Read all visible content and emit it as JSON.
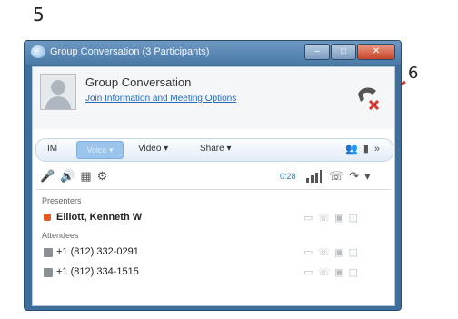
{
  "annotations": {
    "step_left": "5",
    "step_right": "6"
  },
  "window": {
    "title": "Group Conversation (3 Participants)"
  },
  "header": {
    "conversation_title": "Group Conversation",
    "join_link": "Join Information and Meeting Options"
  },
  "modebar": {
    "im_label": "IM",
    "voice_label": "Voice ▾",
    "video_label": "Video ▾",
    "share_label": "Share ▾"
  },
  "controls": {
    "timer": "0:28"
  },
  "participants": {
    "presenters_header": "Presenters",
    "presenters": [
      {
        "name": "Elliott, Kenneth W"
      }
    ],
    "attendees_header": "Attendees",
    "attendees": [
      {
        "name": "+1 (812) 332-0291"
      },
      {
        "name": "+1 (812) 334-1515"
      }
    ]
  },
  "colors": {
    "accent": "#2a6ab8",
    "presence": "#e05a2a",
    "hangup_red": "#d33a2c"
  }
}
